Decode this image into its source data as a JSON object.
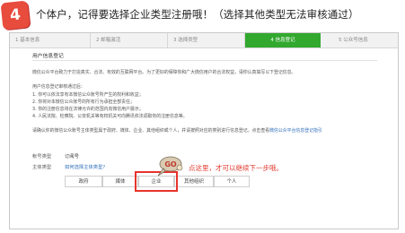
{
  "header": {
    "step_number": "4",
    "title": "个体户，记得要选择企业类型注册哦！（选择其他类型无法审核通过）"
  },
  "steps": [
    {
      "label": "1 基本信息",
      "active": false
    },
    {
      "label": "2 邮箱激活",
      "active": false
    },
    {
      "label": "3 选择类型",
      "active": false
    },
    {
      "label": "4 信息登记",
      "active": true
    },
    {
      "label": "5 公众号信息",
      "active": false
    }
  ],
  "main": {
    "section_title": "用户信息登记",
    "intro": "微信公众平台致力于打造真实、合法、有效的互联网平台。为了更好的保障你和广大微信用户的合法权益，请你认真填写以下登记信息。",
    "notice_title": "用户信息登记审核通过后：",
    "notice_items": [
      "1. 你可以依法享有本微信公众账号所产生的权利和收益；",
      "2. 你将对本微信公众账号的所有行为承担全部责任；",
      "3. 你的注册信息将在法律允许的范围内向微信用户展示；",
      "4. 人民法院、检察院、公安机关等有权机关可向腾讯依法调取你的注册信息等。"
    ],
    "confirm_text": "请确认你的微信公众账号主体类型属于政府、媒体、企业、其他组织或个人，并请按照对应的类别进行信息登记。点击查看",
    "confirm_link": "微信公众平台信息登记指引",
    "account_type_label": "帐号类型",
    "account_type_value": "订阅号",
    "subject_type_label": "主体类型",
    "subject_type_link": "如何选择主体类型？",
    "type_options": [
      "政府",
      "媒体",
      "企业",
      "其他组织",
      "个人"
    ],
    "selected_option": "企业"
  },
  "annotation": {
    "mascot_label": "GO",
    "callout": "点这里，才可以继续下一步哦。"
  },
  "colors": {
    "badge": "#e84c3d",
    "active_step": "#32a82f",
    "highlight": "#e8332c",
    "link": "#2b6cb8"
  }
}
